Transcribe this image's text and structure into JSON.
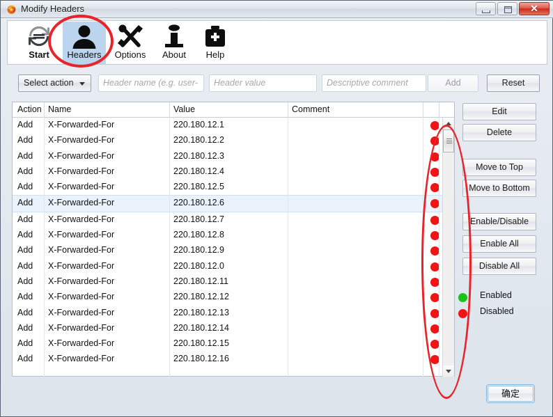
{
  "window": {
    "title": "Modify Headers",
    "app_icon": "firefox-icon",
    "controls": {
      "minimize": "minimize-icon",
      "maximize": "maximize-icon",
      "close": "✕"
    }
  },
  "toolbar": {
    "items": [
      {
        "label": "Start",
        "icon": "refresh-icon",
        "selected": false
      },
      {
        "label": "Headers",
        "icon": "person-icon",
        "selected": true
      },
      {
        "label": "Options",
        "icon": "tools-icon",
        "selected": false
      },
      {
        "label": "About",
        "icon": "info-icon",
        "selected": false
      },
      {
        "label": "Help",
        "icon": "medkit-icon",
        "selected": false
      }
    ]
  },
  "form": {
    "action_select": {
      "value": "Select action",
      "arrow": "chevron-down-icon"
    },
    "header_name": {
      "value": "",
      "placeholder": "Header name (e.g. user-"
    },
    "header_value": {
      "value": "",
      "placeholder": "Header value"
    },
    "comment": {
      "value": "",
      "placeholder": "Descriptive comment"
    },
    "add_label": "Add",
    "reset_label": "Reset"
  },
  "table": {
    "columns": [
      "Action",
      "Name",
      "Value",
      "Comment"
    ],
    "rows": [
      {
        "action": "Add",
        "name": "X-Forwarded-For",
        "value": "220.180.12.1",
        "comment": "",
        "status": "off",
        "selected": false
      },
      {
        "action": "Add",
        "name": "X-Forwarded-For",
        "value": "220.180.12.2",
        "comment": "",
        "status": "off",
        "selected": false
      },
      {
        "action": "Add",
        "name": "X-Forwarded-For",
        "value": "220.180.12.3",
        "comment": "",
        "status": "off",
        "selected": false
      },
      {
        "action": "Add",
        "name": "X-Forwarded-For",
        "value": "220.180.12.4",
        "comment": "",
        "status": "off",
        "selected": false
      },
      {
        "action": "Add",
        "name": "X-Forwarded-For",
        "value": "220.180.12.5",
        "comment": "",
        "status": "off",
        "selected": false
      },
      {
        "action": "Add",
        "name": "X-Forwarded-For",
        "value": "220.180.12.6",
        "comment": "",
        "status": "off",
        "selected": true
      },
      {
        "action": "Add",
        "name": "X-Forwarded-For",
        "value": "220.180.12.7",
        "comment": "",
        "status": "off",
        "selected": false
      },
      {
        "action": "Add",
        "name": "X-Forwarded-For",
        "value": "220.180.12.8",
        "comment": "",
        "status": "off",
        "selected": false
      },
      {
        "action": "Add",
        "name": "X-Forwarded-For",
        "value": "220.180.12.9",
        "comment": "",
        "status": "off",
        "selected": false
      },
      {
        "action": "Add",
        "name": "X-Forwarded-For",
        "value": "220.180.12.0",
        "comment": "",
        "status": "off",
        "selected": false
      },
      {
        "action": "Add",
        "name": "X-Forwarded-For",
        "value": "220.180.12.11",
        "comment": "",
        "status": "off",
        "selected": false
      },
      {
        "action": "Add",
        "name": "X-Forwarded-For",
        "value": "220.180.12.12",
        "comment": "",
        "status": "off",
        "selected": false
      },
      {
        "action": "Add",
        "name": "X-Forwarded-For",
        "value": "220.180.12.13",
        "comment": "",
        "status": "off",
        "selected": false
      },
      {
        "action": "Add",
        "name": "X-Forwarded-For",
        "value": "220.180.12.14",
        "comment": "",
        "status": "off",
        "selected": false
      },
      {
        "action": "Add",
        "name": "X-Forwarded-For",
        "value": "220.180.12.15",
        "comment": "",
        "status": "off",
        "selected": false
      },
      {
        "action": "Add",
        "name": "X-Forwarded-For",
        "value": "220.180.12.16",
        "comment": "",
        "status": "off",
        "selected": false
      }
    ]
  },
  "side_buttons": [
    {
      "label": "Edit"
    },
    {
      "label": "Delete"
    },
    {
      "label": "Move to Top"
    },
    {
      "label": "Move to Bottom"
    },
    {
      "label": "Enable/Disable"
    },
    {
      "label": "Enable All"
    },
    {
      "label": "Disable All"
    }
  ],
  "legend": [
    {
      "label": "Enabled",
      "color": "#19c419"
    },
    {
      "label": "Disabled",
      "color": "#f01414"
    }
  ],
  "footer": {
    "ok_label": "确定"
  },
  "annotations": {
    "color": "#e8242a",
    "shapes": [
      "ellipse-around-headers-tab",
      "ellipse-around-status-column"
    ]
  }
}
